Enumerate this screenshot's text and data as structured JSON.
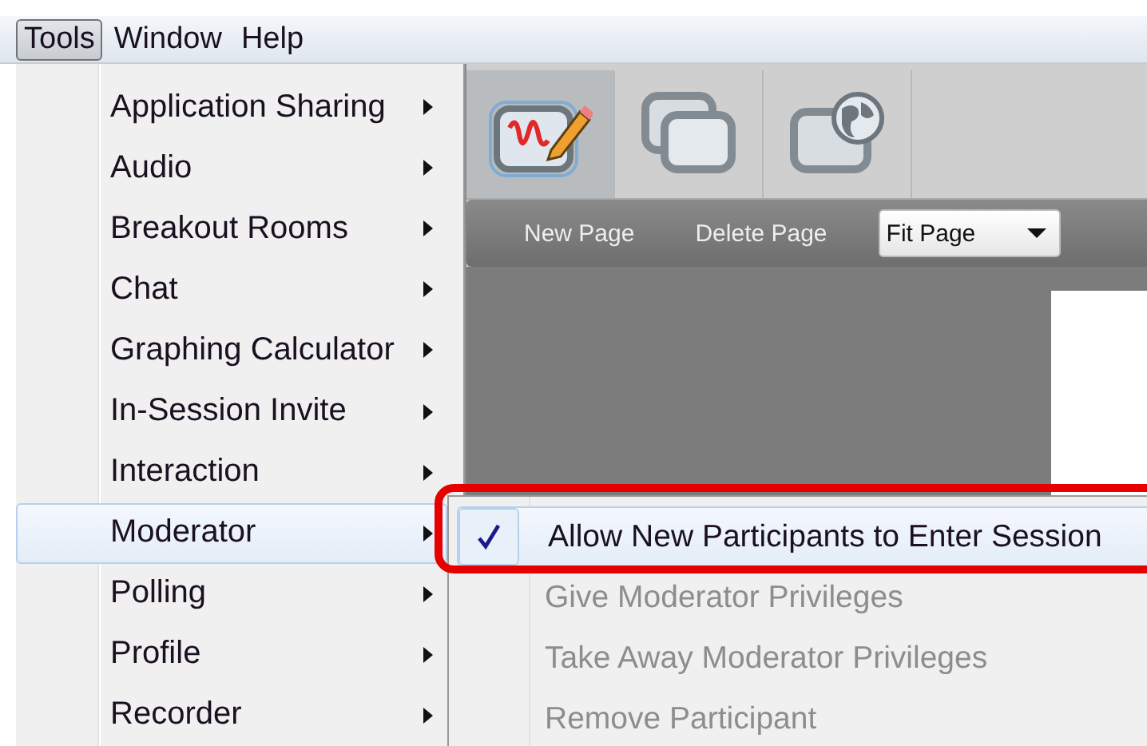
{
  "menubar": [
    {
      "label": "Tools",
      "selected": true
    },
    {
      "label": "Window",
      "selected": false
    },
    {
      "label": "Help",
      "selected": false
    }
  ],
  "menu": {
    "items": [
      {
        "label": "Application Sharing",
        "selected": false
      },
      {
        "label": "Audio",
        "selected": false
      },
      {
        "label": "Breakout Rooms",
        "selected": false
      },
      {
        "label": "Chat",
        "selected": false
      },
      {
        "label": "Graphing Calculator",
        "selected": false
      },
      {
        "label": "In-Session Invite",
        "selected": false
      },
      {
        "label": "Interaction",
        "selected": false
      },
      {
        "label": "Moderator",
        "selected": true
      },
      {
        "label": "Polling",
        "selected": false
      },
      {
        "label": "Profile",
        "selected": false
      },
      {
        "label": "Recorder",
        "selected": false
      }
    ]
  },
  "submenu": {
    "items": [
      {
        "label": "Allow New Participants to Enter Session",
        "checked": true,
        "disabled": false,
        "selected": true
      },
      {
        "label": "Give Moderator Privileges",
        "checked": false,
        "disabled": true,
        "selected": false
      },
      {
        "label": "Take Away Moderator Privileges",
        "checked": false,
        "disabled": true,
        "selected": false
      },
      {
        "label": "Remove Participant",
        "checked": false,
        "disabled": true,
        "selected": false
      }
    ]
  },
  "toolbar": {
    "tabs": [
      {
        "kind": "whiteboard",
        "selected": true
      },
      {
        "kind": "windows",
        "selected": false
      },
      {
        "kind": "web",
        "selected": false
      }
    ],
    "buttons": [
      "New Page",
      "Delete Page"
    ],
    "zoom_select": {
      "value": "Fit Page"
    }
  }
}
